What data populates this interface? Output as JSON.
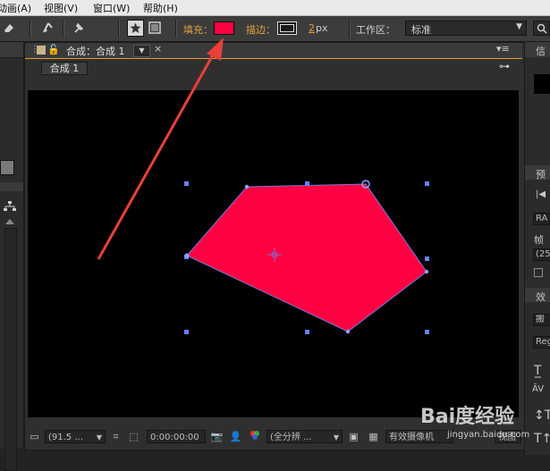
{
  "menu": {
    "items": [
      "动画(A)",
      "视图(V)",
      "窗口(W)",
      "帮助(H)"
    ]
  },
  "toolbar": {
    "fill_label": "填充：",
    "fill_color": "#ff0042",
    "stroke_label": "描边：",
    "stroke_value": "2",
    "stroke_unit": "px",
    "workspace_label": "工作区：",
    "workspace_value": "标准",
    "search_icon": "search-icon"
  },
  "composition": {
    "tab_title": "合成：合成 1",
    "breadcrumb": "合成 1",
    "shape_fill": "#ff0042",
    "shape_stroke": "#6a7fe0"
  },
  "bottombar": {
    "zoom": "(91.5 ...",
    "timecode": "0:00:00:00",
    "resolution": "(全分辨 ...",
    "camera": "有效摄像机",
    "view": "视图"
  },
  "right_panel": {
    "info_label": "信",
    "preview_label": "预",
    "ram_label": "RA",
    "framerate_label": "帧",
    "framerate_value": "(25",
    "effects_label": "效",
    "effects_search": "搬",
    "reg_label": "Reg"
  },
  "watermark": {
    "text": "Bai度经验",
    "url": "jingyan.baidu.com"
  },
  "annotation": {
    "arrow_color": "#e8403a"
  }
}
